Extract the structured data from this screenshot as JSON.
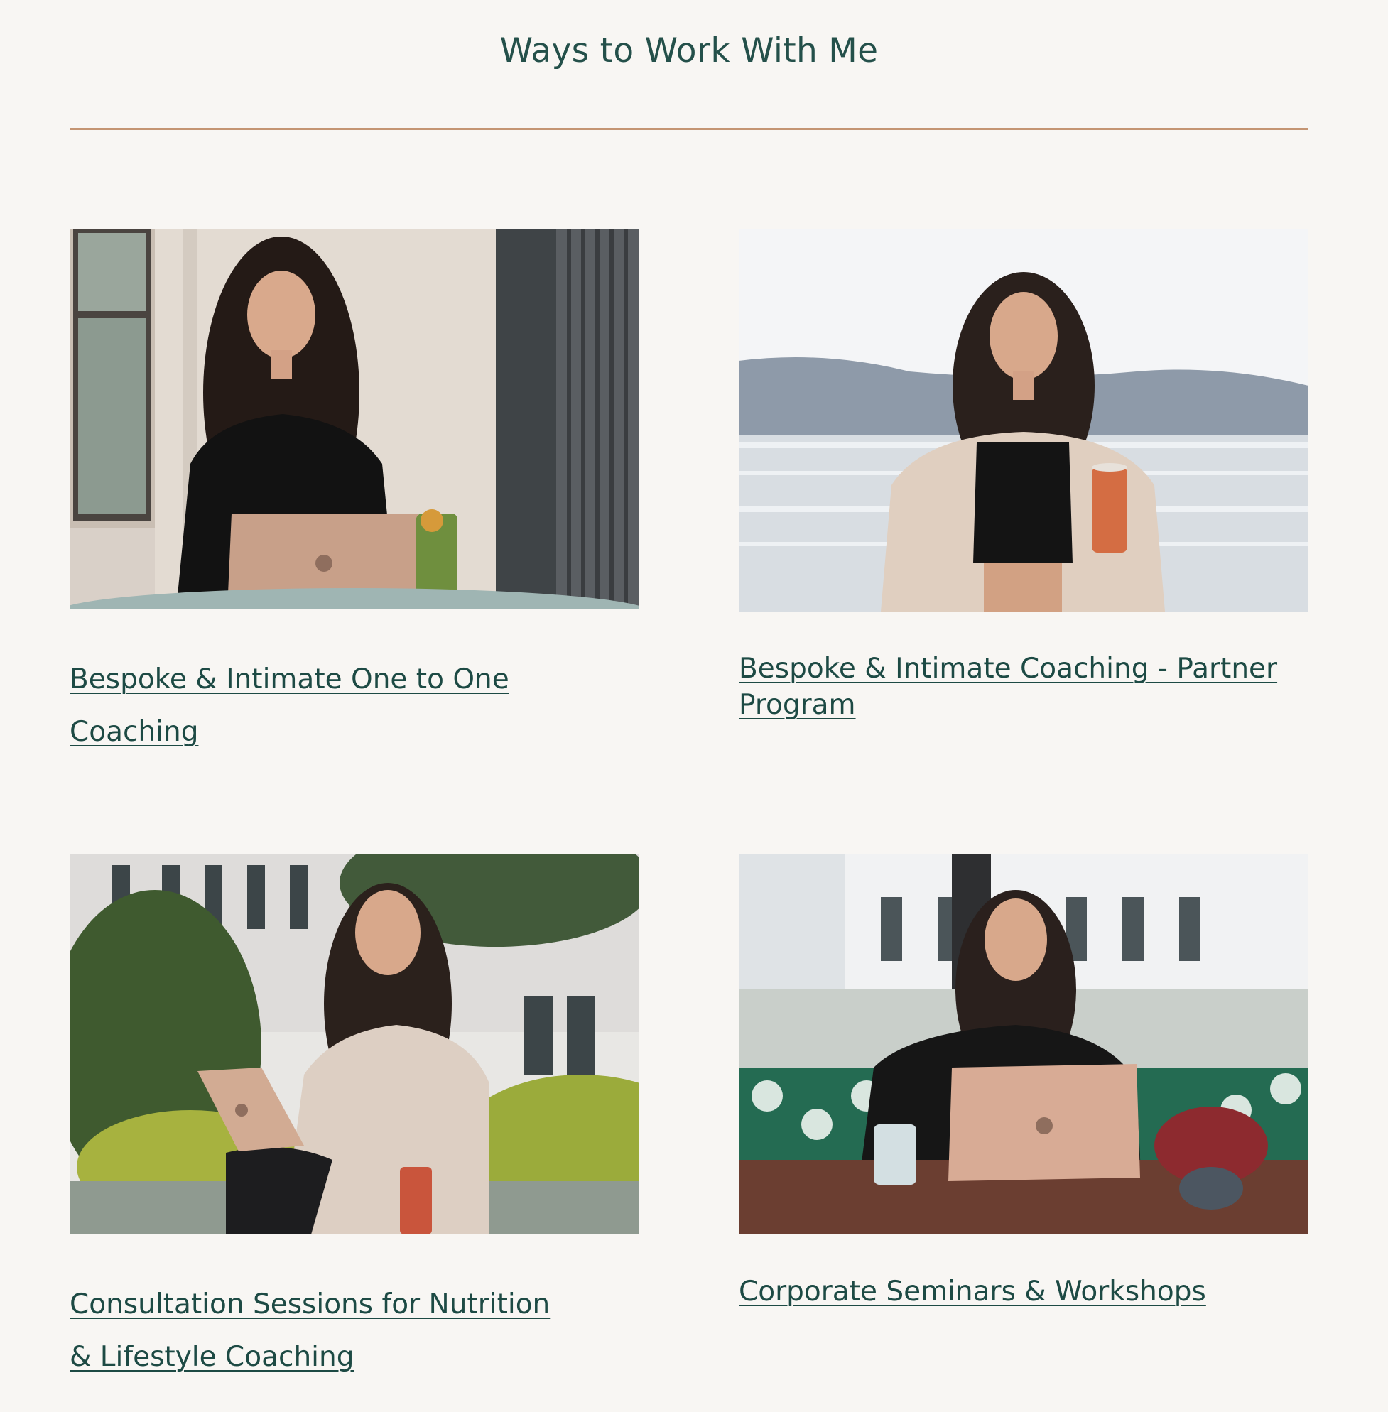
{
  "page": {
    "title": "Ways to Work With Me"
  },
  "colors": {
    "background": "#f8f6f3",
    "heading": "#24504a",
    "link": "#1d4a44",
    "divider": "#c49573"
  },
  "cards": [
    {
      "title": "Bespoke & Intimate One to One Coaching",
      "photo_description_icon": "woman-laptop-terrace-photo"
    },
    {
      "title": "Bespoke & Intimate Coaching - Partner Program",
      "photo_description_icon": "woman-drink-seaside-photo"
    },
    {
      "title": "Consultation Sessions for Nutrition & Lifestyle Coaching",
      "photo_description_icon": "woman-laptop-garden-photo"
    },
    {
      "title": "Corporate Seminars & Workshops",
      "photo_description_icon": "woman-phone-cafe-photo"
    }
  ]
}
